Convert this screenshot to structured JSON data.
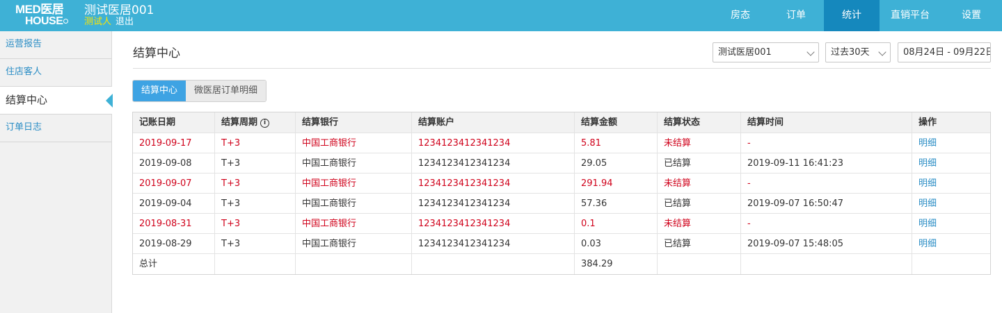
{
  "header": {
    "logo_line1": "MED医居",
    "logo_line2": "HOUSE",
    "hotel_name": "测试医居001",
    "user_name": "测试人",
    "logout_label": "退出"
  },
  "nav": [
    {
      "label": "房态"
    },
    {
      "label": "订单"
    },
    {
      "label": "统计"
    },
    {
      "label": "直销平台"
    },
    {
      "label": "设置"
    }
  ],
  "sidebar": {
    "items": [
      {
        "label": "运营报告"
      },
      {
        "label": "住店客人"
      },
      {
        "label": "结算中心"
      },
      {
        "label": "订单日志"
      }
    ]
  },
  "main": {
    "title": "结算中心",
    "hotel_select": "测试医居001",
    "range_select": "过去30天",
    "date_range": "08月24日 - 09月22日",
    "tabs": [
      {
        "label": "结算中心"
      },
      {
        "label": "微医居订单明细"
      }
    ]
  },
  "table": {
    "headers": [
      "记账日期",
      "结算周期",
      "结算银行",
      "结算账户",
      "结算金额",
      "结算状态",
      "结算时间",
      "操作"
    ],
    "rows": [
      {
        "date": "2019-09-17",
        "cycle": "T+3",
        "bank": "中国工商银行",
        "account": "1234123412341234",
        "amount": "5.81",
        "status": "未结算",
        "time": "-",
        "action": "明细"
      },
      {
        "date": "2019-09-08",
        "cycle": "T+3",
        "bank": "中国工商银行",
        "account": "1234123412341234",
        "amount": "29.05",
        "status": "已结算",
        "time": "2019-09-11 16:41:23",
        "action": "明细"
      },
      {
        "date": "2019-09-07",
        "cycle": "T+3",
        "bank": "中国工商银行",
        "account": "1234123412341234",
        "amount": "291.94",
        "status": "未结算",
        "time": "-",
        "action": "明细"
      },
      {
        "date": "2019-09-04",
        "cycle": "T+3",
        "bank": "中国工商银行",
        "account": "1234123412341234",
        "amount": "57.36",
        "status": "已结算",
        "time": "2019-09-07 16:50:47",
        "action": "明细"
      },
      {
        "date": "2019-08-31",
        "cycle": "T+3",
        "bank": "中国工商银行",
        "account": "1234123412341234",
        "amount": "0.1",
        "status": "未结算",
        "time": "-",
        "action": "明细"
      },
      {
        "date": "2019-08-29",
        "cycle": "T+3",
        "bank": "中国工商银行",
        "account": "1234123412341234",
        "amount": "0.03",
        "status": "已结算",
        "time": "2019-09-07 15:48:05",
        "action": "明细"
      }
    ],
    "total_label": "总计",
    "total_amount": "384.29"
  },
  "colors": {
    "topbar": "#3eb1d6",
    "nav_active": "#1588bd",
    "unsettled": "#d0021b",
    "link": "#2a8dc5",
    "tab_active": "#3ea3e3"
  }
}
